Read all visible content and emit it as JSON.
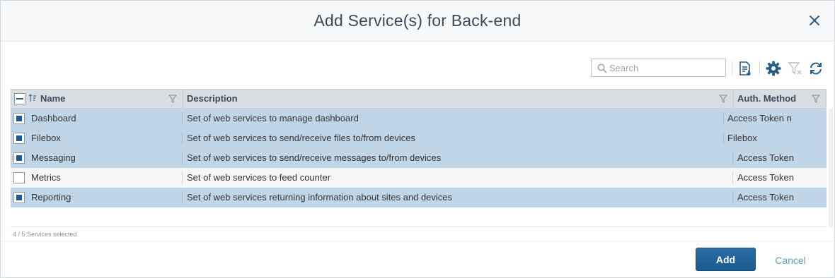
{
  "dialog": {
    "title": "Add Service(s) for Back-end",
    "close_icon": "close-icon"
  },
  "toolbar": {
    "search_placeholder": "Search",
    "icons": [
      "export-icon",
      "gear-icon",
      "clear-filter-icon",
      "refresh-icon"
    ]
  },
  "table": {
    "columns": {
      "name": "Name",
      "description": "Description",
      "auth": "Auth. Method"
    },
    "rows": [
      {
        "selected": true,
        "name": "Dashboard",
        "description": "Set of web services to manage dashboard",
        "auth": "Access Token  n"
      },
      {
        "selected": true,
        "name": "Filebox",
        "description": "Set of web services to send/receive files to/from devices",
        "auth": "Filebox"
      },
      {
        "selected": true,
        "name": "Messaging",
        "description": "Set of web services to send/receive messages to/from devices",
        "auth": "Access Token"
      },
      {
        "selected": false,
        "name": "Metrics",
        "description": "Set of web services to feed counter",
        "auth": "Access Token"
      },
      {
        "selected": true,
        "name": "Reporting",
        "description": "Set of web services returning information about sites and devices",
        "auth": "Access Token"
      }
    ]
  },
  "status": "4 / 5 Services selected",
  "footer": {
    "add_label": "Add",
    "cancel_label": "Cancel"
  },
  "colors": {
    "accent": "#1a5a8e",
    "row_selected": "#c0d5e5",
    "header_bg": "#d8dde1"
  }
}
